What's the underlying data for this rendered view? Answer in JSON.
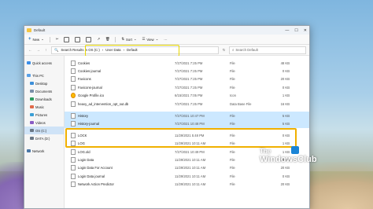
{
  "window": {
    "title": "Default"
  },
  "toolbar": {
    "new_label": "New",
    "sort_label": "Sort",
    "view_label": "View"
  },
  "address": {
    "segments": [
      "Search Results in OS (C:)",
      "User Data",
      "Default"
    ],
    "search_placeholder": "Search Default"
  },
  "sidebar": {
    "items": [
      {
        "label": "Quick access"
      },
      {
        "label": "This PC"
      },
      {
        "label": "Desktop"
      },
      {
        "label": "Documents"
      },
      {
        "label": "Downloads"
      },
      {
        "label": "Music"
      },
      {
        "label": "Pictures"
      },
      {
        "label": "Videos"
      },
      {
        "label": "OS (C:)"
      },
      {
        "label": "DATA (D:)"
      },
      {
        "label": "Network"
      }
    ]
  },
  "files": [
    {
      "name": "Cookies",
      "date": "7/27/2021 7:25 PM",
      "type": "File",
      "size": "48 KB"
    },
    {
      "name": "Cookies-journal",
      "date": "7/27/2021 7:25 PM",
      "type": "File",
      "size": "0 KB"
    },
    {
      "name": "Favicons",
      "date": "7/27/2021 7:25 PM",
      "type": "File",
      "size": "20 KB"
    },
    {
      "name": "Favicons-journal",
      "date": "7/27/2021 7:25 PM",
      "type": "File",
      "size": "0 KB"
    },
    {
      "name": "Google Profile.ico",
      "date": "6/15/2021 7:05 PM",
      "type": "Icon",
      "size": "1 KB"
    },
    {
      "name": "heavy_ad_intervention_opt_out.db",
      "date": "7/27/2021 7:25 PM",
      "type": "Data Base File",
      "size": "16 KB"
    },
    {
      "name": "History",
      "date": "7/27/2021 10:47 PM",
      "type": "File",
      "size": "5 KB"
    },
    {
      "name": "History-journal",
      "date": "7/27/2021 10:48 PM",
      "type": "File",
      "size": "5 KB"
    },
    {
      "name": "LOCK",
      "date": "11/29/2021 5:48 PM",
      "type": "File",
      "size": "0 KB"
    },
    {
      "name": "LOG",
      "date": "11/29/2021 10:11 AM",
      "type": "File",
      "size": "1 KB"
    },
    {
      "name": "LOG.old",
      "date": "7/27/2021 10:49 PM",
      "type": "File",
      "size": "1 KB"
    },
    {
      "name": "Login Data",
      "date": "11/29/2021 10:11 AM",
      "type": "File",
      "size": "20 KB"
    },
    {
      "name": "Login Data For Account",
      "date": "11/29/2021 10:11 AM",
      "type": "File",
      "size": "20 KB"
    },
    {
      "name": "Login Data journal",
      "date": "11/29/2021 10:11 AM",
      "type": "File",
      "size": "0 KB"
    },
    {
      "name": "Network Action Predictor",
      "date": "11/29/2021 10:11 AM",
      "type": "File",
      "size": "20 KB"
    }
  ],
  "watermark": {
    "line1": "The",
    "line2": "WindowsClub"
  },
  "colors": {
    "highlight_yellow": "#e8d700",
    "highlight_orange": "#f0b000",
    "selection": "#cce8ff"
  }
}
